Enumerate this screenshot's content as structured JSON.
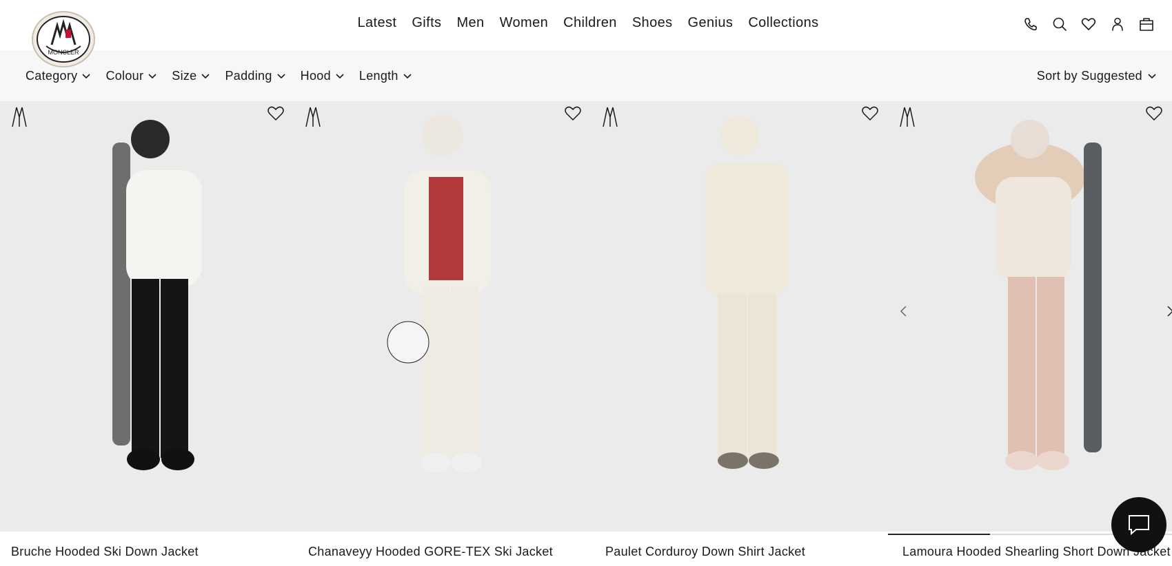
{
  "brand": {
    "name": "Moncler",
    "logo_text": "MONCLER"
  },
  "nav": {
    "items": [
      "Latest",
      "Gifts",
      "Men",
      "Women",
      "Children",
      "Shoes",
      "Genius",
      "Collections"
    ]
  },
  "utility_icons": [
    "phone-icon",
    "search-icon",
    "heart-icon",
    "account-icon",
    "bag-icon"
  ],
  "filters": {
    "items": [
      "Category",
      "Colour",
      "Size",
      "Padding",
      "Hood",
      "Length"
    ],
    "sort_label": "Sort by Suggested"
  },
  "products": [
    {
      "name": "Bruche Hooded Ski Down Jacket",
      "jacket_color": "#f4f4f0",
      "pants_color": "#151515"
    },
    {
      "name": "Chanaveyy Hooded GORE-TEX Ski Jacket",
      "jacket_color": "#f2efe8",
      "pants_color": "#efebe3"
    },
    {
      "name": "Paulet Corduroy Down Shirt Jacket",
      "jacket_color": "#efe9dc",
      "pants_color": "#ebe5d6"
    },
    {
      "name": "Lamoura Hooded Shearling Short Down Jacket",
      "jacket_color": "#efe6dd",
      "pants_color": "#e0c0b3"
    }
  ],
  "carousel": {
    "current_slide_fraction": 0.36
  },
  "colors": {
    "text": "#1a1a1a",
    "filter_bar_bg": "#f7f7f7",
    "image_bg": "#ebebeb",
    "chat_bg": "#111111"
  }
}
